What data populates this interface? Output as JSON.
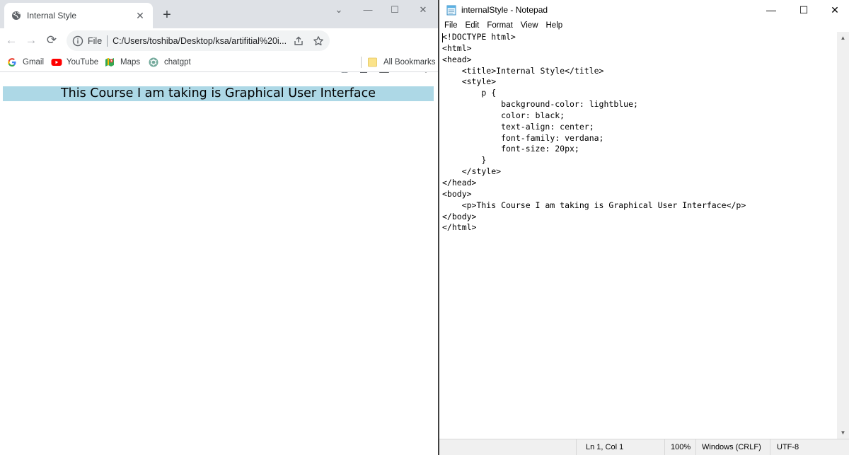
{
  "browser": {
    "tab_title": "Internal Style",
    "tab_close": "✕",
    "new_tab": "+",
    "chevron": "⌄",
    "minimize": "—",
    "maximize": "☐",
    "close": "✕",
    "back": "←",
    "forward": "→",
    "reload": "⟳",
    "omnibox_scheme": "File",
    "omnibox_url": "C:/Users/toshiba/Desktop/ksa/artifitial%20i...",
    "bookmarks": [
      {
        "label": "Gmail"
      },
      {
        "label": "YouTube"
      },
      {
        "label": "Maps"
      },
      {
        "label": "chatgpt"
      }
    ],
    "all_bookmarks": "All Bookmarks",
    "page_paragraph": "This Course I am taking is Graphical User Interface",
    "paragraph_bg": "#add8e6"
  },
  "notepad": {
    "title": "internalStyle - Notepad",
    "minimize": "—",
    "maximize": "☐",
    "close": "✕",
    "menu": [
      "File",
      "Edit",
      "Format",
      "View",
      "Help"
    ],
    "code": "<!DOCTYPE html>\n<html>\n<head>\n    <title>Internal Style</title>\n    <style>\n        p {\n            background-color: lightblue;\n            color: black;\n            text-align: center;\n            font-family: verdana;\n            font-size: 20px;\n        }\n    </style>\n</head>\n<body>\n    <p>This Course I am taking is Graphical User Interface</p>\n</body>\n</html>",
    "scroll_up": "▲",
    "scroll_down": "▼",
    "status": {
      "position": "Ln 1, Col 1",
      "zoom": "100%",
      "line_ending": "Windows (CRLF)",
      "encoding": "UTF-8"
    }
  }
}
